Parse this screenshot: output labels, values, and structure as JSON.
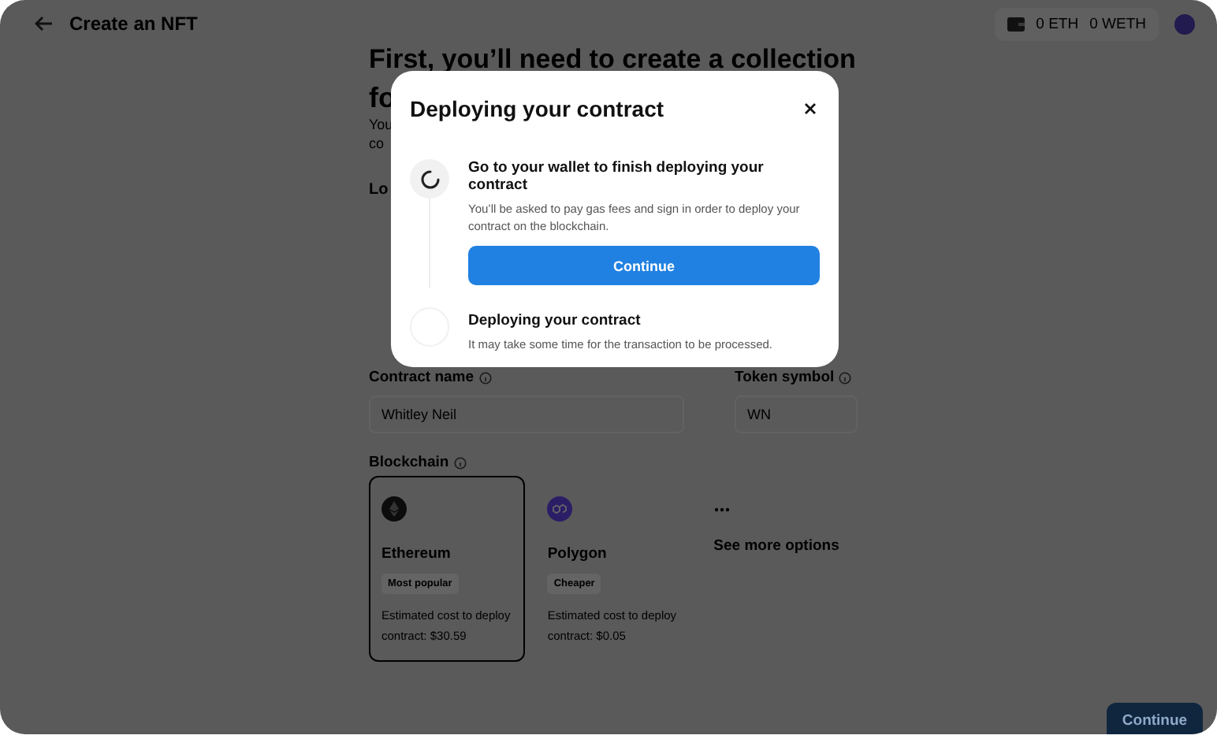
{
  "header": {
    "title": "Create an NFT",
    "balances": [
      "0 ETH",
      "0 WETH"
    ]
  },
  "page": {
    "heading": "First, you’ll need to create a collection",
    "heading_cut": "fo",
    "intro_cut": [
      "You",
      "co"
    ],
    "logo_label_cut": "Lo",
    "fields": [
      {
        "label": "Contract name",
        "value": "Whitley Neil"
      },
      {
        "label": "Token symbol",
        "value": "WN"
      }
    ],
    "blockchain_label": "Blockchain",
    "chains": [
      {
        "kind": "ethereum",
        "name": "Ethereum",
        "tag": "Most popular",
        "cost": "Estimated cost to deploy contract: $30.59",
        "selected": true,
        "color": "#0c0c0c"
      },
      {
        "kind": "polygon",
        "name": "Polygon",
        "tag": "Cheaper",
        "cost": "Estimated cost to deploy contract: $0.05",
        "selected": false,
        "color": "#2b1d66"
      },
      {
        "kind": "more",
        "name": "See more options",
        "selected": false
      }
    ],
    "continue": "Continue"
  },
  "modal": {
    "title": "Deploying your contract",
    "steps": [
      {
        "kind": "in_progress",
        "title": "Go to your wallet to finish deploying your contract",
        "text": "You’ll be asked to pay gas fees and sign in order to deploy your contract on the blockchain.",
        "button": "Continue"
      },
      {
        "kind": "pending",
        "title": "Deploying your contract",
        "text": "It may take some time for the transaction to be processed."
      }
    ]
  }
}
